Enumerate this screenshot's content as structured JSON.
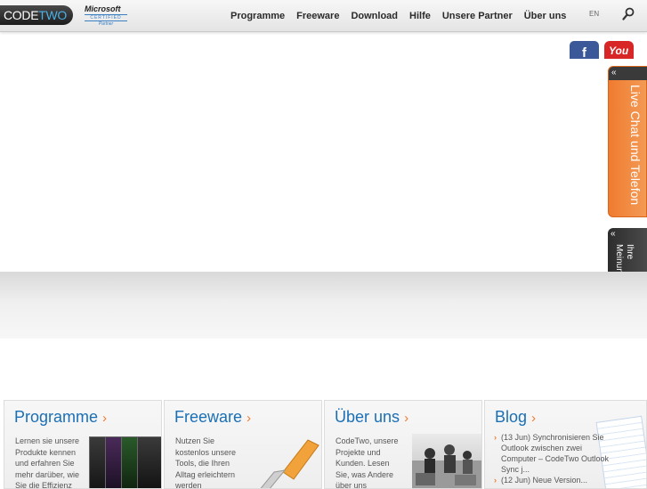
{
  "header": {
    "logo_code": "CODE",
    "logo_two": "TWO",
    "ms_line1": "Microsoft",
    "ms_line2": "CERTIFIED",
    "ms_line3": "Partner",
    "nav": [
      "Programme",
      "Freeware",
      "Download",
      "Hilfe",
      "Unsere Partner",
      "Über uns"
    ],
    "lang": "EN",
    "search_icon": "search-icon"
  },
  "social": {
    "facebook_icon": "facebook-icon",
    "facebook_letter": "f",
    "youtube_label": "You"
  },
  "side_tabs": {
    "chat_cap": "«",
    "chat_label": "Live Chat und Telefon",
    "chat_color": "#f07b2f",
    "feedback_cap": "«",
    "feedback_label": "Ihre Meinung"
  },
  "boxes": [
    {
      "title": "Programme",
      "arrow": "›",
      "text": [
        "Lernen sie unsere",
        "Produkte kennen",
        "und erfahren Sie",
        "mehr darüber, wie",
        "Sie die Effizienz"
      ]
    },
    {
      "title": "Freeware",
      "arrow": "›",
      "text": [
        "Nutzen Sie",
        "kostenlos unsere",
        "Tools, die Ihren",
        "Alltag erleichtern",
        "werden"
      ]
    },
    {
      "title": "Über uns",
      "arrow": "›",
      "text": [
        "CodeTwo, unsere",
        "Projekte und",
        "Kunden. Lesen",
        "Sie, was Andere",
        "über uns"
      ]
    },
    {
      "title": "Blog",
      "arrow": "›",
      "posts": [
        "(13 Jun) Synchronisieren Sie Outlook zwischen zwei Computer – CodeTwo Outlook Sync j...",
        "(12 Jun) Neue Version..."
      ]
    }
  ],
  "colors": {
    "brand_blue": "#1b6fb5",
    "accent_orange": "#f07b2f"
  }
}
